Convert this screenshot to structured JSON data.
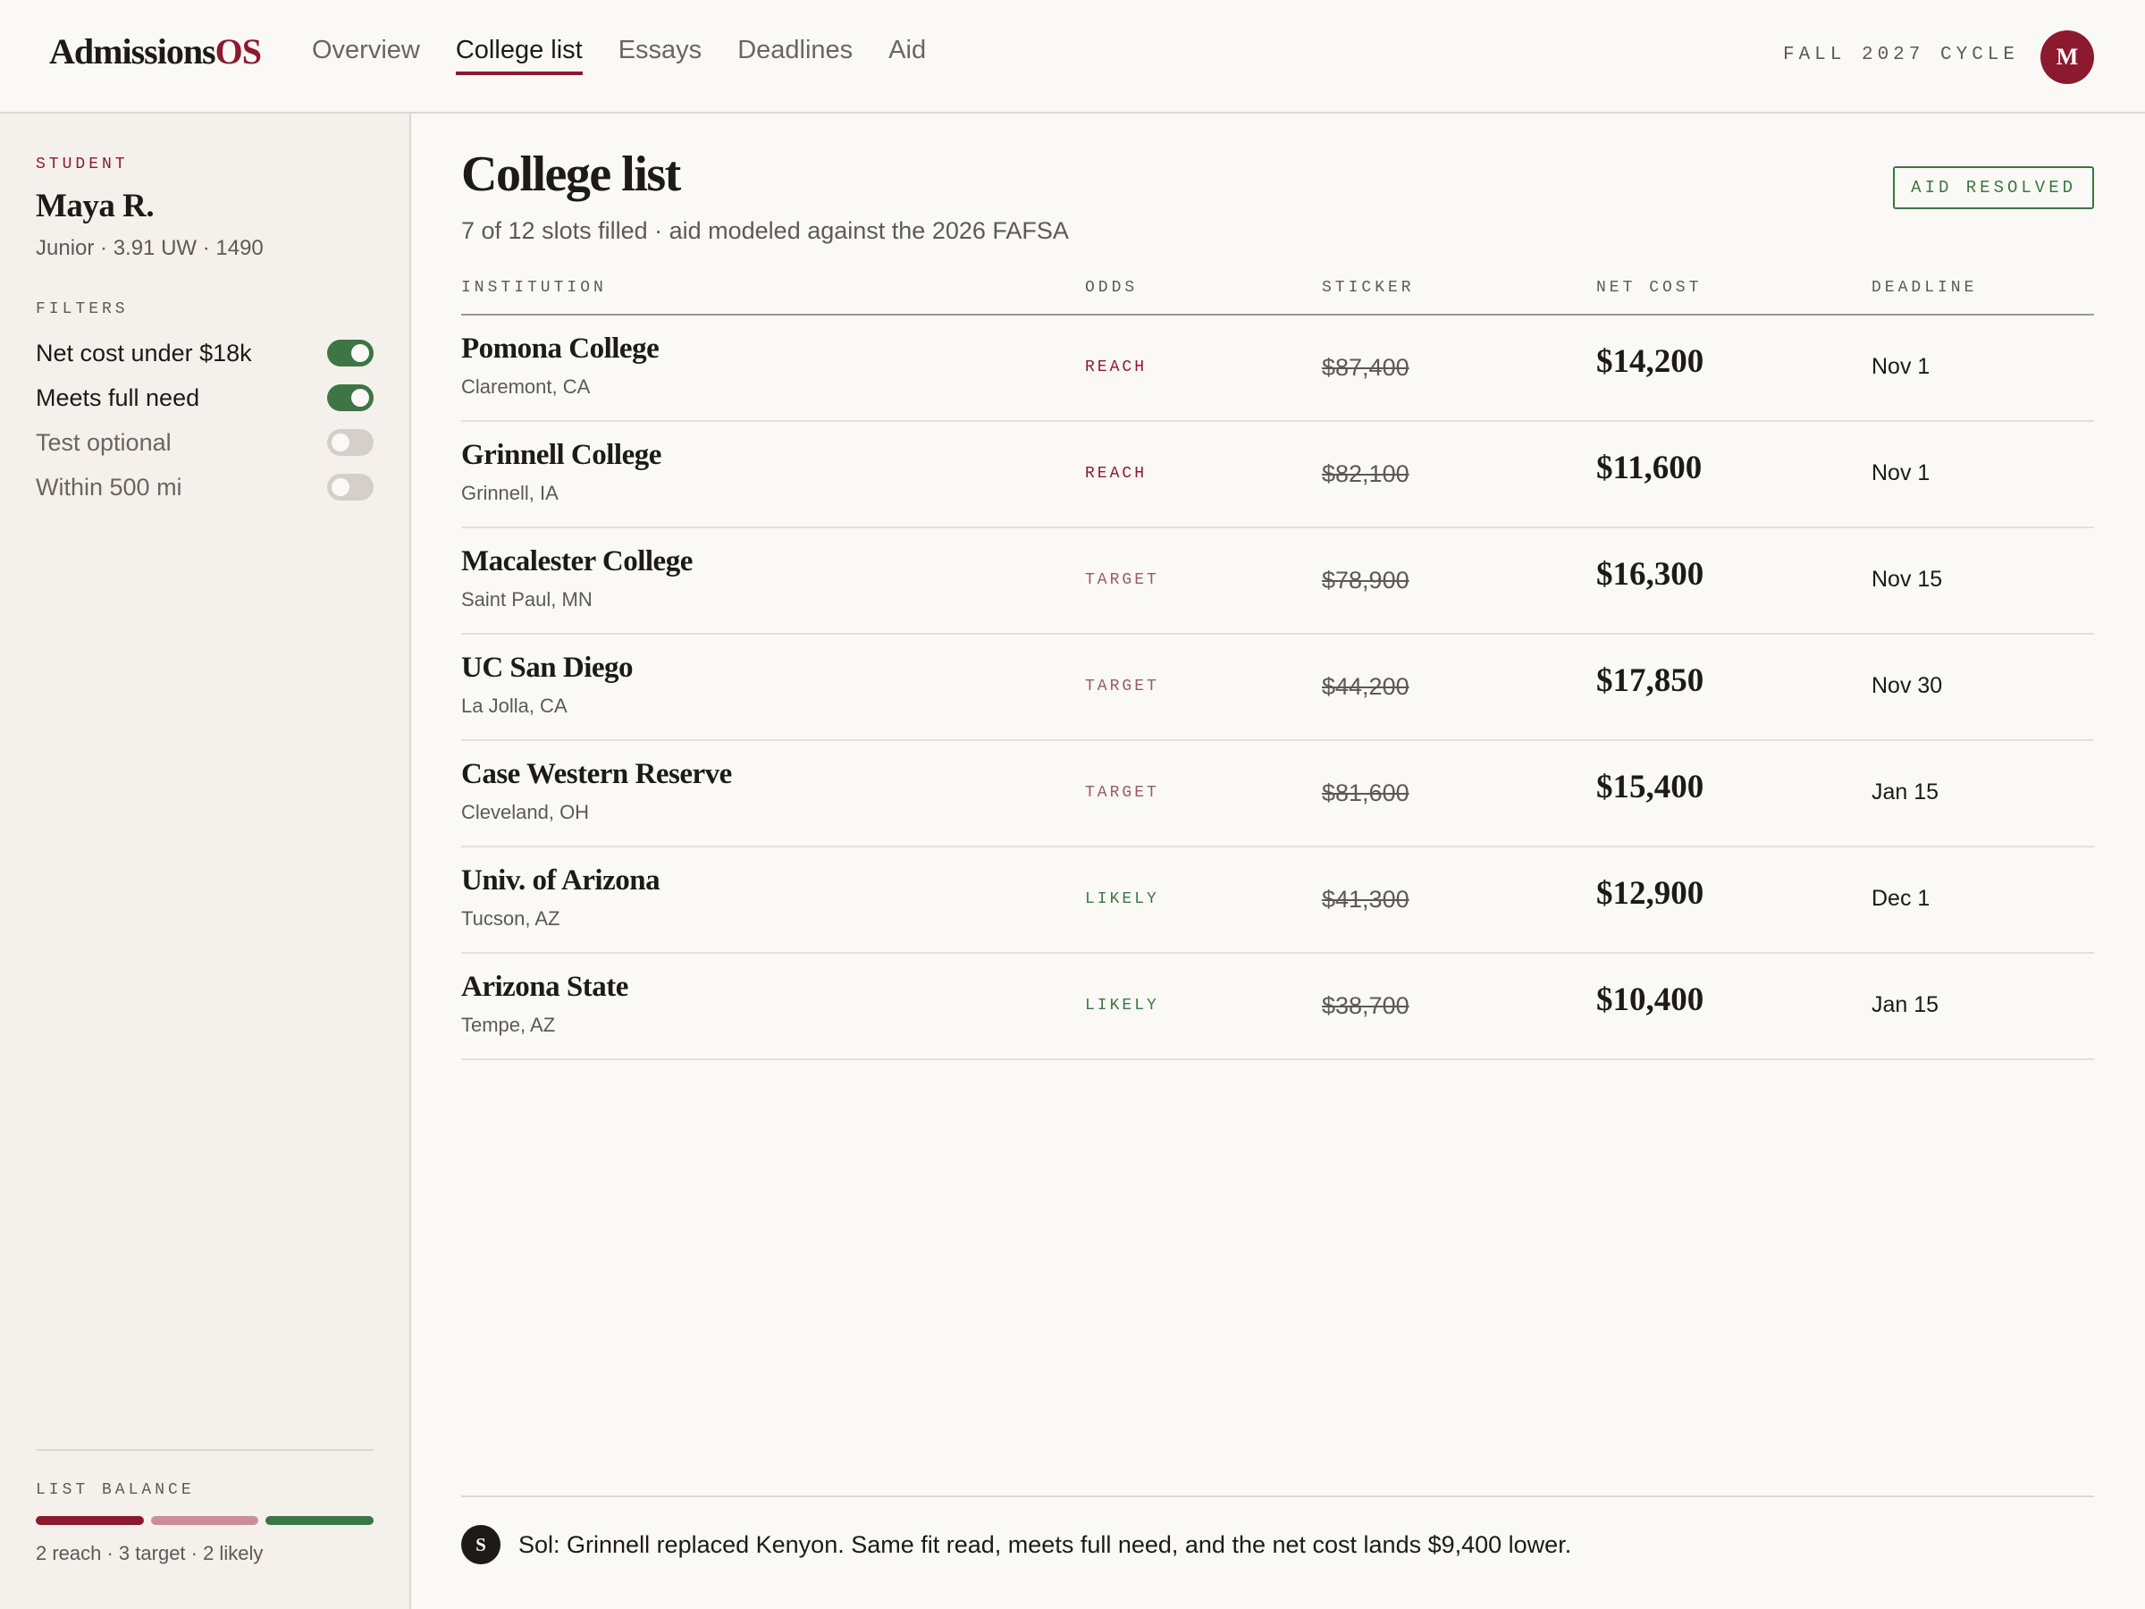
{
  "header": {
    "brand_main": "Admissions",
    "brand_accent": "OS",
    "nav": [
      {
        "label": "Overview",
        "active": false
      },
      {
        "label": "College list",
        "active": true
      },
      {
        "label": "Essays",
        "active": false
      },
      {
        "label": "Deadlines",
        "active": false
      },
      {
        "label": "Aid",
        "active": false
      }
    ],
    "cycle": "FALL 2027 CYCLE",
    "avatar_initial": "M"
  },
  "sidebar": {
    "student_label": "STUDENT",
    "student_name": "Maya R.",
    "student_meta": "Junior · 3.91 UW · 1490",
    "filters_label": "FILTERS",
    "filters": [
      {
        "label": "Net cost under $18k",
        "on": true
      },
      {
        "label": "Meets full need",
        "on": true
      },
      {
        "label": "Test optional",
        "on": false
      },
      {
        "label": "Within 500 mi",
        "on": false
      }
    ],
    "balance_label": "LIST BALANCE",
    "balance_segments": [
      {
        "kind": "reach",
        "count": 2,
        "color": "#8b1a2e"
      },
      {
        "kind": "target",
        "count": 3,
        "color": "#c98f98"
      },
      {
        "kind": "likely",
        "count": 2,
        "color": "#3d7544"
      }
    ],
    "balance_text": "2 reach · 3 target · 2 likely"
  },
  "main": {
    "title": "College list",
    "subtitle": "7 of 12 slots filled · aid modeled against the 2026 FAFSA",
    "status_badge": "AID RESOLVED",
    "columns": {
      "institution": "INSTITUTION",
      "odds": "ODDS",
      "sticker": "STICKER",
      "net_cost": "NET COST",
      "deadline": "DEADLINE"
    },
    "rows": [
      {
        "name": "Pomona College",
        "location": "Claremont, CA",
        "odds": "REACH",
        "sticker": "$87,400",
        "net": "$14,200",
        "deadline": "Nov 1"
      },
      {
        "name": "Grinnell College",
        "location": "Grinnell, IA",
        "odds": "REACH",
        "sticker": "$82,100",
        "net": "$11,600",
        "deadline": "Nov 1"
      },
      {
        "name": "Macalester College",
        "location": "Saint Paul, MN",
        "odds": "TARGET",
        "sticker": "$78,900",
        "net": "$16,300",
        "deadline": "Nov 15"
      },
      {
        "name": "UC San Diego",
        "location": "La Jolla, CA",
        "odds": "TARGET",
        "sticker": "$44,200",
        "net": "$17,850",
        "deadline": "Nov 30"
      },
      {
        "name": "Case Western Reserve",
        "location": "Cleveland, OH",
        "odds": "TARGET",
        "sticker": "$81,600",
        "net": "$15,400",
        "deadline": "Jan 15"
      },
      {
        "name": "Univ. of Arizona",
        "location": "Tucson, AZ",
        "odds": "LIKELY",
        "sticker": "$41,300",
        "net": "$12,900",
        "deadline": "Dec 1"
      },
      {
        "name": "Arizona State",
        "location": "Tempe, AZ",
        "odds": "LIKELY",
        "sticker": "$38,700",
        "net": "$10,400",
        "deadline": "Jan 15"
      }
    ],
    "odds_colors": {
      "REACH": "#8b1a2e",
      "TARGET": "#9a5a64",
      "LIKELY": "#3d7544"
    }
  },
  "note": {
    "avatar_initial": "S",
    "text": "Sol: Grinnell replaced Kenyon. Same fit read, meets full need, and the net cost lands $9,400 lower."
  }
}
